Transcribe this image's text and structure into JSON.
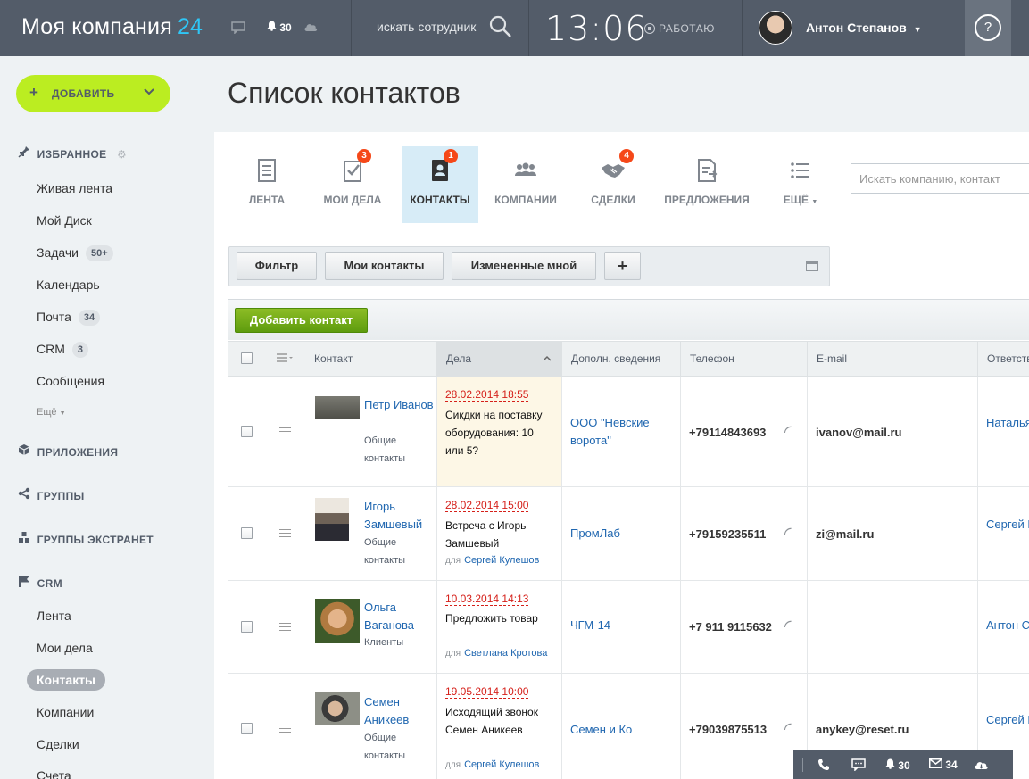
{
  "header": {
    "brand": "Моя компания",
    "brand_num": "24",
    "notif_count": "30",
    "search_label": "искать сотрудник",
    "clock": "13:06",
    "work_status": "РАБОТАЮ",
    "user_name": "Антон Степанов",
    "help": "?"
  },
  "sidebar": {
    "add_label": "ДОБАВИТЬ",
    "favorites": "ИЗБРАННОЕ",
    "items": [
      {
        "label": "Живая лента",
        "badge": ""
      },
      {
        "label": "Мой Диск",
        "badge": ""
      },
      {
        "label": "Задачи",
        "badge": "50+"
      },
      {
        "label": "Календарь",
        "badge": ""
      },
      {
        "label": "Почта",
        "badge": "34"
      },
      {
        "label": "CRM",
        "badge": "3"
      },
      {
        "label": "Сообщения",
        "badge": ""
      }
    ],
    "more": "Ещё",
    "apps": "ПРИЛОЖЕНИЯ",
    "groups": "ГРУППЫ",
    "extranet": "ГРУППЫ ЭКСТРАНЕТ",
    "crm": "CRM",
    "crm_items": [
      "Лента",
      "Мои дела",
      "Контакты",
      "Компании",
      "Сделки",
      "Счета"
    ]
  },
  "main": {
    "title": "Список контактов",
    "tabs": [
      {
        "label": "ЛЕНТА",
        "count": ""
      },
      {
        "label": "МОИ ДЕЛА",
        "count": "3"
      },
      {
        "label": "КОНТАКТЫ",
        "count": "1"
      },
      {
        "label": "КОМПАНИИ",
        "count": ""
      },
      {
        "label": "СДЕЛКИ",
        "count": "4"
      },
      {
        "label": "ПРЕДЛОЖЕНИЯ",
        "count": ""
      },
      {
        "label": "ЕЩЁ",
        "count": ""
      }
    ],
    "search_placeholder": "Искать компанию, контакт",
    "filters": [
      "Фильтр",
      "Мои контакты",
      "Измененные мной",
      "+"
    ],
    "add_contact": "Добавить контакт",
    "columns": [
      "Контакт",
      "Дела",
      "Дополн. сведения",
      "Телефон",
      "E-mail",
      "Ответств"
    ],
    "rows": [
      {
        "name": "Петр Иванов",
        "type": "Общие контакты",
        "deal_date": "28.02.2014 18:55",
        "deal_title": "Сикдки на поставку оборудования: 10 или 5?",
        "deal_for_label": "",
        "deal_for": "",
        "company": "ООО \"Невские ворота\"",
        "phone": "+79114843693",
        "email": "ivanov@mail.ru",
        "resp": "Наталья Сергеевна"
      },
      {
        "name": "Игорь Замшевый",
        "type": "Общие контакты",
        "deal_date": "28.02.2014 15:00",
        "deal_title": "Встреча с Игорь Замшевый",
        "deal_for_label": "для",
        "deal_for": "Сергей Кулешов",
        "company": "ПромЛаб",
        "phone": "+79159235511",
        "email": "zi@mail.ru",
        "resp": "Сергей Кулешов"
      },
      {
        "name": "Ольга Ваганова",
        "type": "Клиенты",
        "deal_date": "10.03.2014 14:13",
        "deal_title": "Предложить товар",
        "deal_for_label": "для",
        "deal_for": "Светлана Кротова",
        "company": "ЧГМ-14",
        "phone": "+7 911 9115632",
        "email": "",
        "resp": "Антон Степанов"
      },
      {
        "name": "Семен Аникеев",
        "type": "Общие контакты",
        "deal_date": "19.05.2014 10:00",
        "deal_title": "Исходящий звонок Семен Аникеев",
        "deal_for_label": "для",
        "deal_for": "Сергей Кулешов",
        "company": "Семен и Ко",
        "phone": "+79039875513",
        "email": "anykey@reset.ru",
        "resp": "Сергей Кулешов"
      }
    ]
  },
  "bottom": {
    "notif": "30",
    "mail": "34"
  },
  "colors": {
    "topbar": "#535c69",
    "accent_add": "#bbed21",
    "link": "#2067b0",
    "deal_date": "#d5201a",
    "badge_red": "#f54819"
  }
}
